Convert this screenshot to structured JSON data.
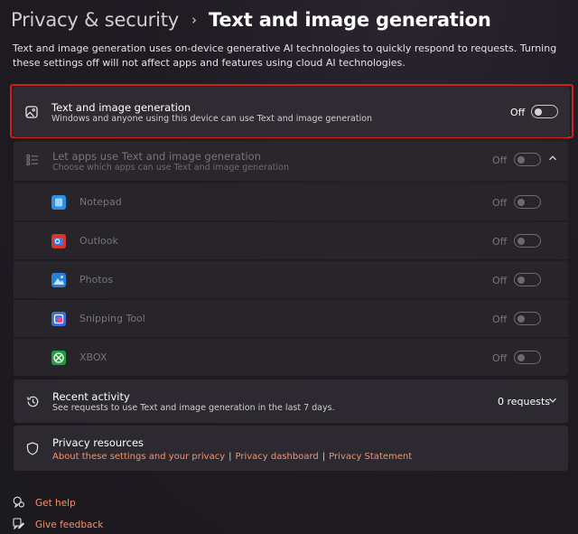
{
  "breadcrumb": {
    "parent": "Privacy & security",
    "separator": "›",
    "current": "Text and image generation"
  },
  "description": "Text and image generation uses on-device generative AI technologies to quickly respond to requests. Turning these settings off will not affect apps and features using cloud AI technologies.",
  "main_setting": {
    "icon": "image-icon",
    "title": "Text and image generation",
    "subtitle": "Windows and anyone using this device can use Text and image generation",
    "state": "Off",
    "highlight_color": "#cf1f1f"
  },
  "apps_setting": {
    "icon": "list-icon",
    "title": "Let apps use Text and image generation",
    "subtitle": "Choose which apps can use Text and image generation",
    "state": "Off",
    "apps": [
      {
        "name": "Notepad",
        "state": "Off",
        "icon": "notepad-icon",
        "color": "#2f8fe6"
      },
      {
        "name": "Outlook",
        "state": "Off",
        "icon": "outlook-icon",
        "color": "#d9342f"
      },
      {
        "name": "Photos",
        "state": "Off",
        "icon": "photos-icon",
        "color": "#2a7fd8"
      },
      {
        "name": "Snipping Tool",
        "state": "Off",
        "icon": "snipping-tool-icon",
        "color": "#3b6fd6"
      },
      {
        "name": "XBOX",
        "state": "Off",
        "icon": "xbox-icon",
        "color": "#1f9e3c"
      }
    ]
  },
  "recent_activity": {
    "icon": "history-icon",
    "title": "Recent activity",
    "subtitle": "See requests to use Text and image generation in the last 7 days.",
    "count": "0 requests"
  },
  "privacy_resources": {
    "icon": "shield-icon",
    "title": "Privacy resources",
    "links": [
      "About these settings and your privacy",
      "Privacy dashboard",
      "Privacy Statement"
    ],
    "separator": "|"
  },
  "footer": {
    "help": "Get help",
    "feedback": "Give feedback"
  },
  "colors": {
    "link": "#f4916c",
    "background": "#1f1b22"
  }
}
